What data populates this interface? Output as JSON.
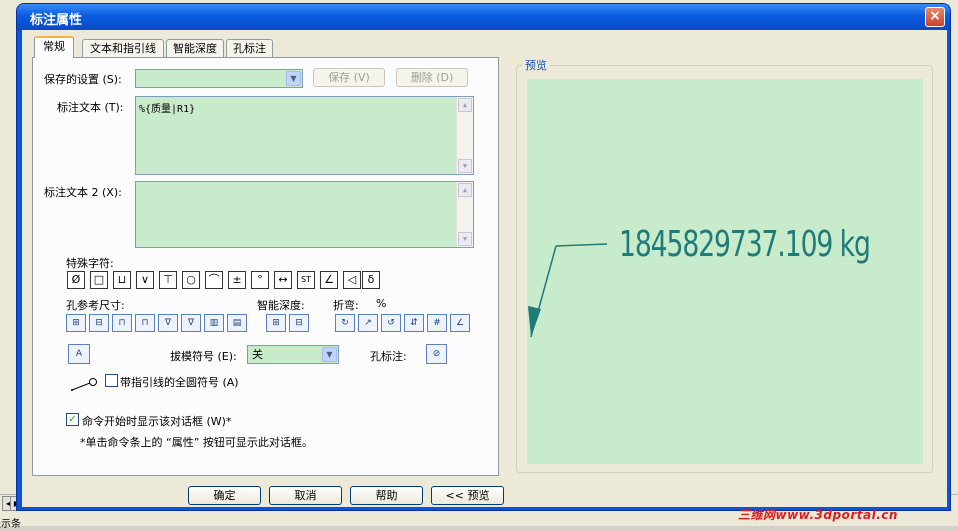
{
  "dialog": {
    "title": "标注属性",
    "close_icon": "×"
  },
  "tabs": [
    {
      "label": "常规"
    },
    {
      "label": "文本和指引线"
    },
    {
      "label": "智能深度"
    },
    {
      "label": "孔标注"
    }
  ],
  "general": {
    "saved_settings_label": "保存的设置 (S):",
    "saved_settings_value": "",
    "save_button": "保存 (V)",
    "delete_button": "删除 (D)",
    "callout_text_label": "标注文本 (T):",
    "callout_text_value": "%{质量|R1}",
    "callout_text2_label": "标注文本 2 (X):",
    "callout_text2_value": "",
    "special_chars_label": "特殊字符:",
    "special_chars": [
      "Ø",
      "□",
      "⊔",
      "∨",
      "⊤",
      "○",
      "⌒",
      "±",
      "°",
      "↔",
      "ST",
      "∠",
      "◁",
      "δ"
    ],
    "hole_ref_label": "孔参考尺寸:",
    "smart_depth_label": "智能深度:",
    "bend_label": "折弯:",
    "bend_percent": "%",
    "draft_symbol_label": "拔模符号 (E):",
    "draft_symbol_value": "关",
    "hole_callout_label": "孔标注:",
    "full_circle_label": "带指引线的全圆符号 (A)",
    "show_dialog_label": "命令开始时显示该对话框 (W)*",
    "show_dialog_checked": true,
    "footnote": "*单击命令条上的 “属性” 按钮可显示此对话框。"
  },
  "preview": {
    "group_label": "预览",
    "value_text": "1845829737.109 kg"
  },
  "footer": {
    "ok": "确定",
    "cancel": "取消",
    "help": "帮助",
    "preview_toggle": "<< 预览"
  },
  "background": {
    "status_text": "提示条"
  },
  "watermark": "三维网www.3dportal.cn"
}
